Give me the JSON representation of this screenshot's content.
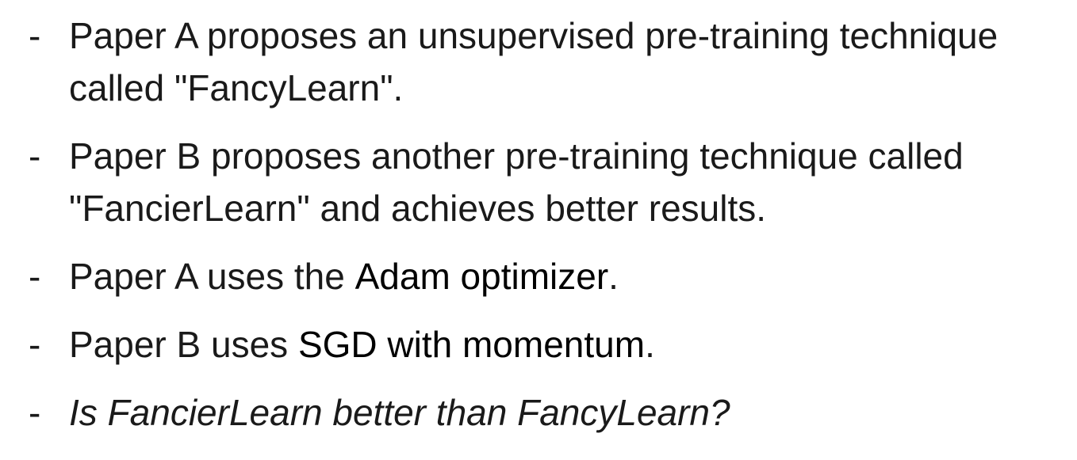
{
  "bullet_marker": "-",
  "items": [
    {
      "text": "Paper A proposes an unsupervised pre-training technique called \"FancyLearn\"."
    },
    {
      "text": "Paper B proposes another pre-training technique called \"FancierLearn\" and achieves better results."
    },
    {
      "prefix": "Paper A uses the ",
      "emphasis": "Adam optimizer",
      "suffix": "."
    },
    {
      "prefix": "Paper B uses ",
      "emphasis": "SGD with momentum",
      "suffix": "."
    },
    {
      "text": "Is FancierLearn better than FancyLearn?"
    }
  ]
}
